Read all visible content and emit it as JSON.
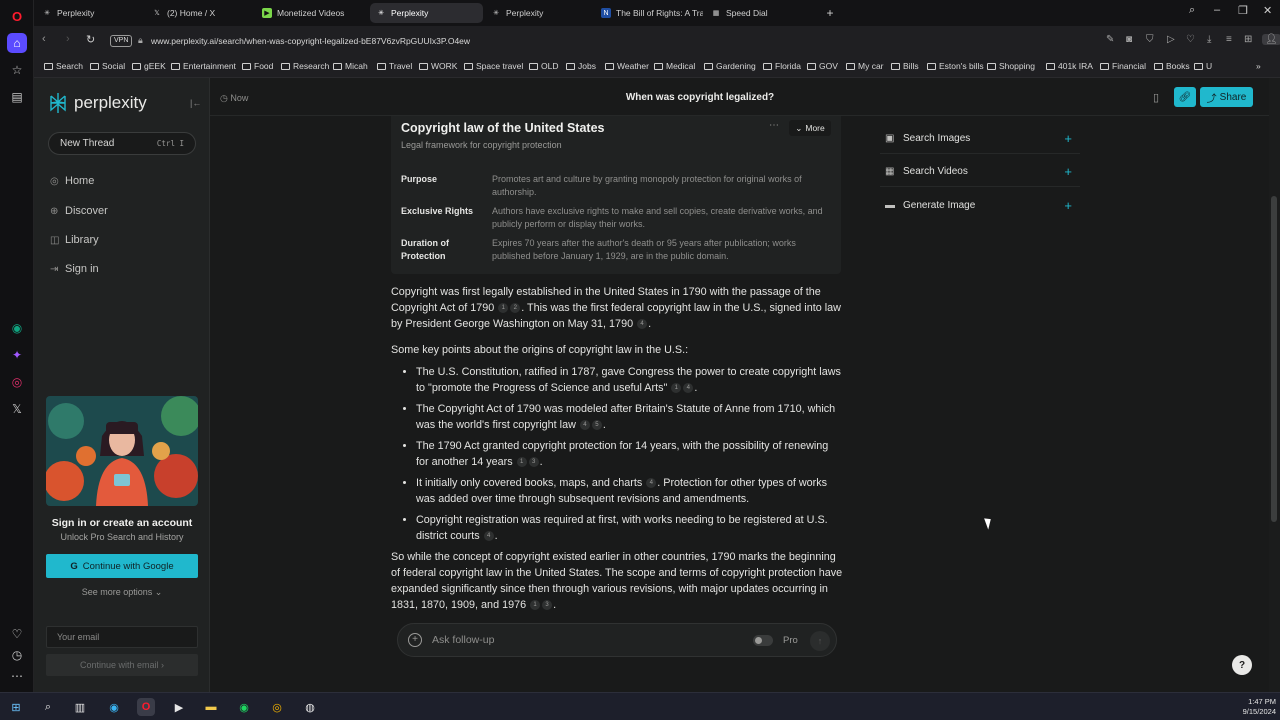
{
  "browser": {
    "tabs": [
      {
        "label": "Perplexity",
        "active": false
      },
      {
        "label": "(2) Home / X",
        "active": false
      },
      {
        "label": "Monetized Videos",
        "active": false
      },
      {
        "label": "Perplexity",
        "active": true
      },
      {
        "label": "Perplexity",
        "active": false
      },
      {
        "label": "The Bill of Rights: A Transcription",
        "active": false
      },
      {
        "label": "Speed Dial",
        "active": false
      }
    ],
    "new_tab": "+",
    "vpn_label": "VPN",
    "url": "www.perplexity.ai/search/when-was-copyright-legalized-bE87V6zvRpGUUIx3P.O4ew",
    "bookmarks": [
      "Search",
      "Social",
      "gEEK",
      "Entertainment",
      "Food",
      "Research",
      "Micah",
      "Travel",
      "WORK",
      "Space travel",
      "OLD",
      "Jobs",
      "Weather",
      "Medical",
      "Gardening",
      "Florida",
      "GOV",
      "My car",
      "Bills",
      "Eston's bills",
      "Shopping",
      "401k IRA",
      "Financial",
      "Books",
      "U"
    ],
    "bookmarks_overflow": "»"
  },
  "sidebar": {
    "brand": "perplexity",
    "new_thread": {
      "label": "New Thread",
      "shortcut": "Ctrl I"
    },
    "nav": [
      {
        "label": "Home",
        "icon": "home-icon"
      },
      {
        "label": "Discover",
        "icon": "globe-icon"
      },
      {
        "label": "Library",
        "icon": "library-icon"
      },
      {
        "label": "Sign in",
        "icon": "sign-in-icon"
      }
    ],
    "signin_title": "Sign in or create an account",
    "signin_subtitle": "Unlock Pro Search and History",
    "google_button": "Continue with Google",
    "more_options": "See more options",
    "email_placeholder": "Your email",
    "email_button": "Continue with email"
  },
  "thread": {
    "time": "Now",
    "title": "When was copyright legalized?",
    "share_label": "Share"
  },
  "knowledge_card": {
    "title": "Copyright law of the United States",
    "subtitle": "Legal framework for copyright protection",
    "more_label": "More",
    "rows": [
      {
        "key": "Purpose",
        "value": "Promotes art and culture by granting monopoly protection for original works of authorship."
      },
      {
        "key": "Exclusive Rights",
        "value": "Authors have exclusive rights to make and sell copies, create derivative works, and publicly perform or display their works."
      },
      {
        "key": "Duration of Protection",
        "value": "Expires 70 years after the author's death or 95 years after publication; works published before January 1, 1929, are in the public domain."
      }
    ]
  },
  "answer": {
    "p1": {
      "a": "Copyright was first legally established in the United States in 1790 with the passage of the Copyright Act of 1790",
      "c1": [
        "1",
        "2"
      ],
      "b": ". This was the first federal copyright law in the U.S., signed into law by President George Washington on May 31, 1790",
      "c2": [
        "4"
      ],
      "c": "."
    },
    "p2": "Some key points about the origins of copyright law in the U.S.:",
    "bullets": [
      {
        "text": "The U.S. Constitution, ratified in 1787, gave Congress the power to create copyright laws to \"promote the Progress of Science and useful Arts\"",
        "cites": [
          "1",
          "4"
        ],
        "tail": "."
      },
      {
        "text": "The Copyright Act of 1790 was modeled after Britain's Statute of Anne from 1710, which was the world's first copyright law",
        "cites": [
          "4",
          "5"
        ],
        "tail": "."
      },
      {
        "text": "The 1790 Act granted copyright protection for 14 years, with the possibility of renewing for another 14 years",
        "cites": [
          "1",
          "3"
        ],
        "tail": "."
      },
      {
        "text": "It initially only covered books, maps, and charts",
        "cites": [
          "4"
        ],
        "tail": ". Protection for other types of works was added over time through subsequent revisions and amendments."
      },
      {
        "text": "Copyright registration was required at first, with works needing to be registered at U.S. district courts",
        "cites": [
          "4"
        ],
        "tail": "."
      }
    ],
    "p3": {
      "a": "So while the concept of copyright existed earlier in other countries, 1790 marks the beginning of federal copyright law in the United States. The scope and terms of copyright protection have expanded significantly since then through various revisions, with major updates occurring in 1831, 1870, 1909, and 1976",
      "cites": [
        "1",
        "3"
      ],
      "b": "."
    }
  },
  "followup": {
    "placeholder": "Ask follow-up",
    "pro_label": "Pro"
  },
  "right_panel": [
    {
      "label": "Search Images",
      "icon": "image-icon"
    },
    {
      "label": "Search Videos",
      "icon": "video-icon"
    },
    {
      "label": "Generate Image",
      "icon": "generate-image-icon"
    }
  ],
  "help_label": "?",
  "taskbar": {
    "time": "1:47 PM",
    "date": "9/15/2024"
  },
  "colors": {
    "accent": "#20b8cd",
    "background": "#191a1a",
    "sidebar": "#202222"
  }
}
